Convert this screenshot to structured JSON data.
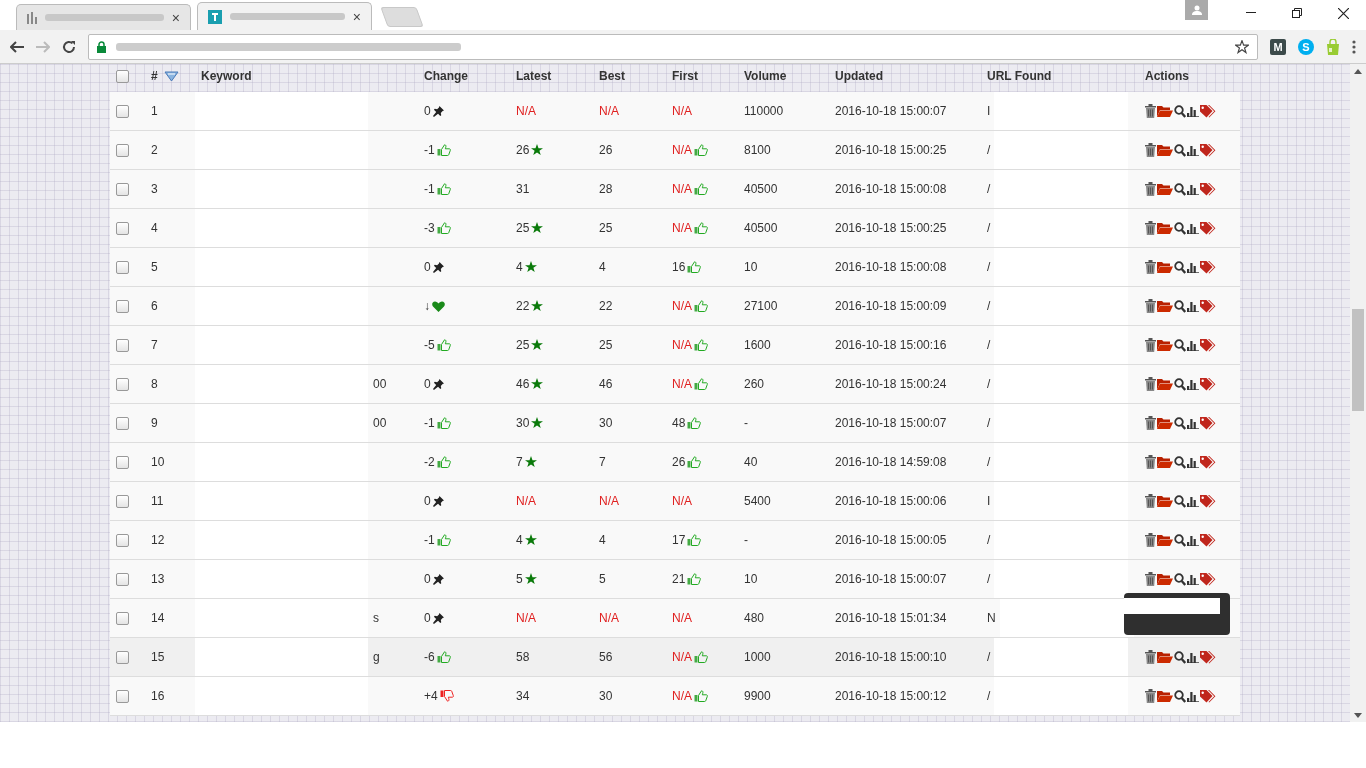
{
  "browser": {
    "tabs": [
      {
        "selected": false,
        "close": "×"
      },
      {
        "selected": true,
        "close": "×"
      }
    ],
    "extensions": [
      {
        "kind": "m",
        "label": "M"
      },
      {
        "kind": "skype",
        "label": "S"
      },
      {
        "kind": "bag"
      }
    ]
  },
  "table": {
    "header_checked": false,
    "columns": [
      "#",
      "Keyword",
      "Change",
      "Latest",
      "Best",
      "First",
      "Volume",
      "Updated",
      "URL Found",
      "Actions"
    ],
    "rows": [
      {
        "checked": false,
        "highlighted": false,
        "tooltip": false,
        "num": "1",
        "change": {
          "text": "0",
          "kind": "pin"
        },
        "latest": {
          "text": "N/A",
          "missing": true
        },
        "best": {
          "text": "N/A",
          "missing": true
        },
        "first": {
          "text": "N/A",
          "missing": true
        },
        "volume": "110000",
        "updated": "2016-10-18 15:00:07",
        "url": "I"
      },
      {
        "checked": false,
        "highlighted": false,
        "tooltip": false,
        "num": "2",
        "change": {
          "text": "-1",
          "kind": "up"
        },
        "latest": {
          "text": "26",
          "missing": false,
          "kind": "star"
        },
        "best": {
          "text": "26",
          "missing": false
        },
        "first": {
          "text": "N/A",
          "missing": true,
          "kind": "up"
        },
        "volume": "8100",
        "updated": "2016-10-18 15:00:25",
        "url": "/"
      },
      {
        "checked": false,
        "highlighted": false,
        "tooltip": false,
        "num": "3",
        "change": {
          "text": "-1",
          "kind": "up"
        },
        "latest": {
          "text": "31",
          "missing": false
        },
        "best": {
          "text": "28",
          "missing": false
        },
        "first": {
          "text": "N/A",
          "missing": true,
          "kind": "up"
        },
        "volume": "40500",
        "updated": "2016-10-18 15:00:08",
        "url": "/"
      },
      {
        "checked": false,
        "highlighted": false,
        "tooltip": false,
        "num": "4",
        "change": {
          "text": "-3",
          "kind": "up"
        },
        "latest": {
          "text": "25",
          "missing": false,
          "kind": "star"
        },
        "best": {
          "text": "25",
          "missing": false
        },
        "first": {
          "text": "N/A",
          "missing": true,
          "kind": "up"
        },
        "volume": "40500",
        "updated": "2016-10-18 15:00:25",
        "url": "/"
      },
      {
        "checked": false,
        "highlighted": false,
        "tooltip": false,
        "num": "5",
        "change": {
          "text": "0",
          "kind": "pin"
        },
        "latest": {
          "text": "4",
          "missing": false,
          "kind": "star"
        },
        "best": {
          "text": "4",
          "missing": false
        },
        "first": {
          "text": "16",
          "missing": false,
          "kind": "up"
        },
        "volume": "10",
        "updated": "2016-10-18 15:00:08",
        "url": "/"
      },
      {
        "checked": false,
        "highlighted": false,
        "tooltip": false,
        "num": "6",
        "change": {
          "text": "↓",
          "kind": "heart"
        },
        "latest": {
          "text": "22",
          "missing": false,
          "kind": "star"
        },
        "best": {
          "text": "22",
          "missing": false
        },
        "first": {
          "text": "N/A",
          "missing": true,
          "kind": "up"
        },
        "volume": "27100",
        "updated": "2016-10-18 15:00:09",
        "url": "/"
      },
      {
        "checked": false,
        "highlighted": false,
        "tooltip": false,
        "num": "7",
        "change": {
          "text": "-5",
          "kind": "up"
        },
        "latest": {
          "text": "25",
          "missing": false,
          "kind": "star"
        },
        "best": {
          "text": "25",
          "missing": false
        },
        "first": {
          "text": "N/A",
          "missing": true,
          "kind": "up"
        },
        "volume": "1600",
        "updated": "2016-10-18 15:00:16",
        "url": "/"
      },
      {
        "checked": false,
        "highlighted": false,
        "tooltip": false,
        "num": "8",
        "keyword": "00",
        "change": {
          "text": "0",
          "kind": "pin"
        },
        "latest": {
          "text": "46",
          "missing": false,
          "kind": "star"
        },
        "best": {
          "text": "46",
          "missing": false
        },
        "first": {
          "text": "N/A",
          "missing": true,
          "kind": "up"
        },
        "volume": "260",
        "updated": "2016-10-18 15:00:24",
        "url": "/"
      },
      {
        "checked": false,
        "highlighted": false,
        "tooltip": false,
        "num": "9",
        "keyword": "00",
        "change": {
          "text": "-1",
          "kind": "up"
        },
        "latest": {
          "text": "30",
          "missing": false,
          "kind": "star"
        },
        "best": {
          "text": "30",
          "missing": false
        },
        "first": {
          "text": "48",
          "missing": false,
          "kind": "up"
        },
        "volume": "-",
        "updated": "2016-10-18 15:00:07",
        "url": "/"
      },
      {
        "checked": false,
        "highlighted": false,
        "tooltip": false,
        "num": "10",
        "change": {
          "text": "-2",
          "kind": "up"
        },
        "latest": {
          "text": "7",
          "missing": false,
          "kind": "star"
        },
        "best": {
          "text": "7",
          "missing": false
        },
        "first": {
          "text": "26",
          "missing": false,
          "kind": "up"
        },
        "volume": "40",
        "updated": "2016-10-18 14:59:08",
        "url": "/"
      },
      {
        "checked": false,
        "highlighted": false,
        "tooltip": false,
        "num": "11",
        "change": {
          "text": "0",
          "kind": "pin"
        },
        "latest": {
          "text": "N/A",
          "missing": true
        },
        "best": {
          "text": "N/A",
          "missing": true
        },
        "first": {
          "text": "N/A",
          "missing": true
        },
        "volume": "5400",
        "updated": "2016-10-18 15:00:06",
        "url": "I"
      },
      {
        "checked": false,
        "highlighted": false,
        "tooltip": false,
        "num": "12",
        "change": {
          "text": "-1",
          "kind": "up"
        },
        "latest": {
          "text": "4",
          "missing": false,
          "kind": "star"
        },
        "best": {
          "text": "4",
          "missing": false
        },
        "first": {
          "text": "17",
          "missing": false,
          "kind": "up"
        },
        "volume": "-",
        "updated": "2016-10-18 15:00:05",
        "url": "/"
      },
      {
        "checked": false,
        "highlighted": false,
        "tooltip": false,
        "num": "13",
        "change": {
          "text": "0",
          "kind": "pin"
        },
        "latest": {
          "text": "5",
          "missing": false,
          "kind": "star"
        },
        "best": {
          "text": "5",
          "missing": false
        },
        "first": {
          "text": "21",
          "missing": false,
          "kind": "up"
        },
        "volume": "10",
        "updated": "2016-10-18 15:00:07",
        "url": "/"
      },
      {
        "checked": false,
        "highlighted": false,
        "tooltip": true,
        "num": "14",
        "keyword": "s",
        "change": {
          "text": "0",
          "kind": "pin"
        },
        "latest": {
          "text": "N/A",
          "missing": true
        },
        "best": {
          "text": "N/A",
          "missing": true
        },
        "first": {
          "text": "N/A",
          "missing": true
        },
        "volume": "480",
        "updated": "2016-10-18 15:01:34",
        "url": "N"
      },
      {
        "checked": false,
        "highlighted": true,
        "tooltip": false,
        "num": "15",
        "keyword": "g",
        "change": {
          "text": "-6",
          "kind": "up"
        },
        "latest": {
          "text": "58",
          "missing": false
        },
        "best": {
          "text": "56",
          "missing": false
        },
        "first": {
          "text": "N/A",
          "missing": true,
          "kind": "up"
        },
        "volume": "1000",
        "updated": "2016-10-18 15:00:10",
        "url": "/"
      },
      {
        "checked": false,
        "highlighted": false,
        "tooltip": false,
        "num": "16",
        "change": {
          "text": "+4",
          "kind": "down"
        },
        "latest": {
          "text": "34",
          "missing": false
        },
        "best": {
          "text": "30",
          "missing": false
        },
        "first": {
          "text": "N/A",
          "missing": true,
          "kind": "up"
        },
        "volume": "9900",
        "updated": "2016-10-18 15:00:12",
        "url": "/"
      }
    ]
  }
}
